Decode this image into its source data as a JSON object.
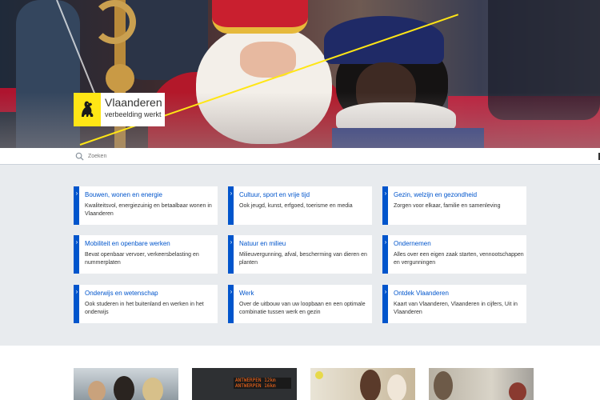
{
  "logo": {
    "brand": "Vlaanderen",
    "tagline": "verbeelding werkt"
  },
  "search": {
    "placeholder": "Zoeken"
  },
  "themes": [
    {
      "title": "Bouwen, wonen en energie",
      "description": "Kwaliteitsvol, energiezuinig en betaalbaar wonen in Vlaanderen"
    },
    {
      "title": "Cultuur, sport en vrije tijd",
      "description": "Ook jeugd, kunst, erfgoed, toerisme en media"
    },
    {
      "title": "Gezin, welzijn en gezondheid",
      "description": "Zorgen voor elkaar, familie en samenleving"
    },
    {
      "title": "Mobiliteit en openbare werken",
      "description": "Bevat openbaar vervoer, verkeersbelasting en nummerplaten"
    },
    {
      "title": "Natuur en milieu",
      "description": "Milieuvergunning, afval, bescherming van dieren en planten"
    },
    {
      "title": "Ondernemen",
      "description": "Alles over een eigen zaak starten, vennootschappen en vergunningen"
    },
    {
      "title": "Onderwijs en wetenschap",
      "description": "Ook studeren in het buitenland en werken in het onderwijs"
    },
    {
      "title": "Werk",
      "description": "Over de uitbouw van uw loopbaan en een optimale combinatie tussen werk en gezin"
    },
    {
      "title": "Ontdek Vlaanderen",
      "description": "Kaart van Vlaanderen, Vlaanderen in cijfers, Uit in Vlaanderen"
    }
  ],
  "photos": {
    "sign_line1": "ANTWERPEN  12km",
    "sign_line2": "ANTWERPEN  16km"
  },
  "colors": {
    "accent": "#0055cc",
    "logo_yellow": "#ffe615",
    "band_bg": "#e8ebee"
  }
}
